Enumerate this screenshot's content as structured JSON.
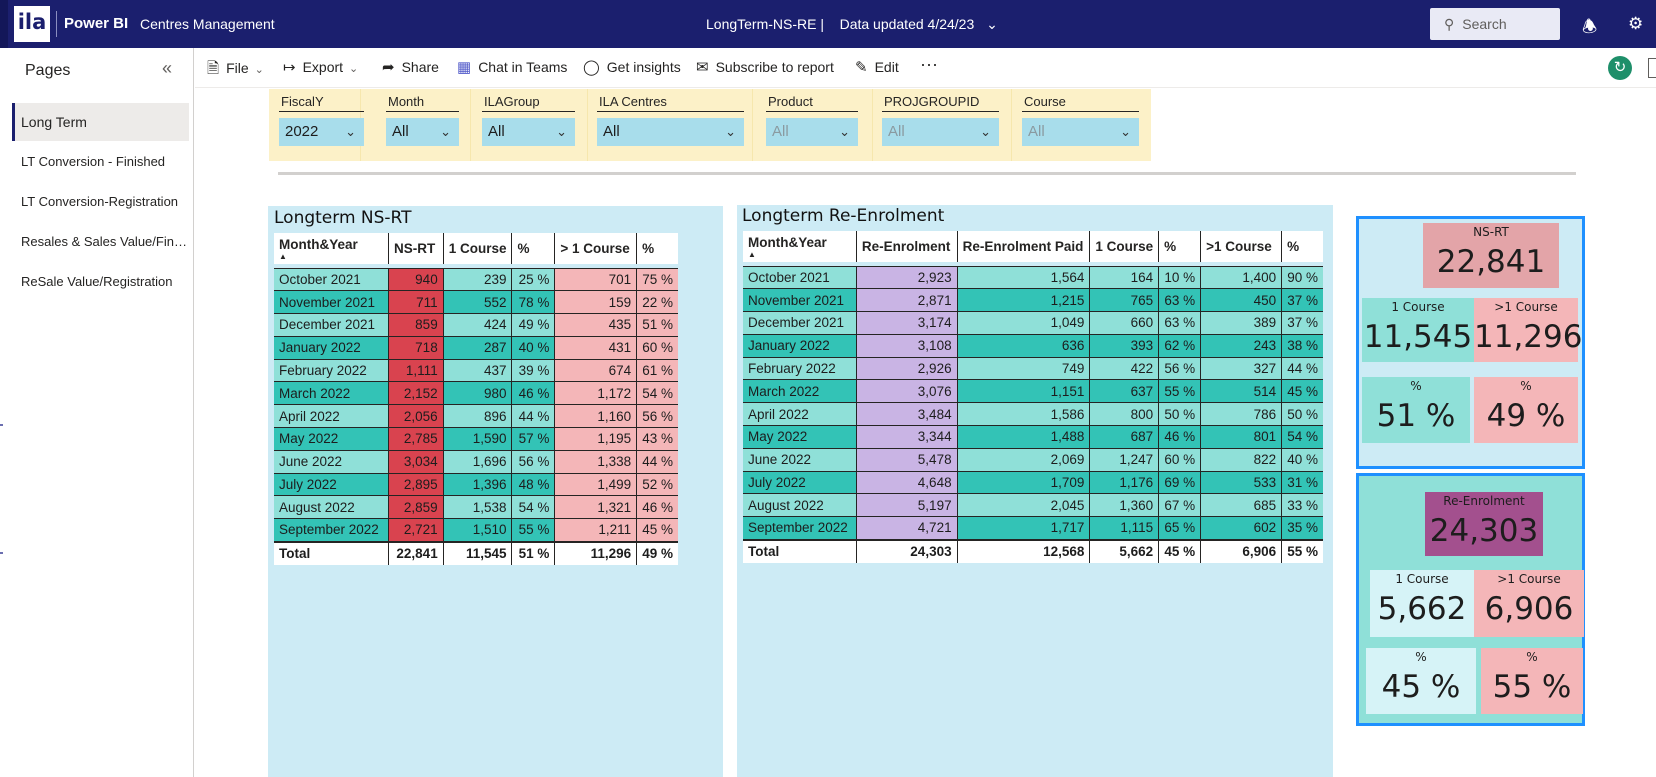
{
  "topbar": {
    "logo": "ila",
    "app_name": "Power BI",
    "workspace": "Centres Management",
    "report_title": "LongTerm-NS-RE  |",
    "data_updated": "Data updated 4/24/23",
    "search_placeholder": "Search"
  },
  "pages_pane": {
    "title": "Pages",
    "items": [
      {
        "label": "Long Term",
        "active": true
      },
      {
        "label": "LT Conversion - Finished",
        "active": false
      },
      {
        "label": "LT Conversion-Registration",
        "active": false
      },
      {
        "label": "Resales & Sales Value/Finished",
        "active": false
      },
      {
        "label": "ReSale Value/Registration",
        "active": false
      }
    ]
  },
  "actionbar": {
    "file": "File",
    "export": "Export",
    "share": "Share",
    "chat": "Chat in Teams",
    "insights": "Get insights",
    "subscribe": "Subscribe to report",
    "edit": "Edit",
    "more": "···"
  },
  "slicers": [
    {
      "label": "FiscalY",
      "value": "2022",
      "enabled": true
    },
    {
      "label": "Month",
      "value": "All",
      "enabled": true
    },
    {
      "label": "ILAGroup",
      "value": "All",
      "enabled": true
    },
    {
      "label": "ILA Centres",
      "value": "All",
      "enabled": true
    },
    {
      "label": "Product",
      "value": "All",
      "enabled": false
    },
    {
      "label": "PROJGROUPID",
      "value": "All",
      "enabled": false
    },
    {
      "label": "Course",
      "value": "All",
      "enabled": false
    }
  ],
  "nsrt": {
    "title": "Longterm NS-RT",
    "headers": [
      "Month&Year",
      "NS-RT",
      "1 Course",
      "%",
      "> 1 Course",
      "%"
    ],
    "rows": [
      [
        "October 2021",
        "940",
        "239",
        "25 %",
        "701",
        "75 %"
      ],
      [
        "November 2021",
        "711",
        "552",
        "78 %",
        "159",
        "22 %"
      ],
      [
        "December 2021",
        "859",
        "424",
        "49 %",
        "435",
        "51 %"
      ],
      [
        "January 2022",
        "718",
        "287",
        "40 %",
        "431",
        "60 %"
      ],
      [
        "February 2022",
        "1,111",
        "437",
        "39 %",
        "674",
        "61 %"
      ],
      [
        "March 2022",
        "2,152",
        "980",
        "46 %",
        "1,172",
        "54 %"
      ],
      [
        "April 2022",
        "2,056",
        "896",
        "44 %",
        "1,160",
        "56 %"
      ],
      [
        "May 2022",
        "2,785",
        "1,590",
        "57 %",
        "1,195",
        "43 %"
      ],
      [
        "June 2022",
        "3,034",
        "1,696",
        "56 %",
        "1,338",
        "44 %"
      ],
      [
        "July 2022",
        "2,895",
        "1,396",
        "48 %",
        "1,499",
        "52 %"
      ],
      [
        "August 2022",
        "2,859",
        "1,538",
        "54 %",
        "1,321",
        "46 %"
      ],
      [
        "September 2022",
        "2,721",
        "1,510",
        "55 %",
        "1,211",
        "45 %"
      ]
    ],
    "total": [
      "Total",
      "22,841",
      "11,545",
      "51 %",
      "11,296",
      "49 %"
    ]
  },
  "reenrol": {
    "title": "Longterm Re-Enrolment",
    "headers": [
      "Month&Year",
      "Re-Enrolment",
      "Re-Enrolment Paid",
      "1 Course",
      "%",
      ">1 Course",
      "%"
    ],
    "rows": [
      [
        "October 2021",
        "2,923",
        "1,564",
        "164",
        "10 %",
        "1,400",
        "90 %"
      ],
      [
        "November 2021",
        "2,871",
        "1,215",
        "765",
        "63 %",
        "450",
        "37 %"
      ],
      [
        "December 2021",
        "3,174",
        "1,049",
        "660",
        "63 %",
        "389",
        "37 %"
      ],
      [
        "January 2022",
        "3,108",
        "636",
        "393",
        "62 %",
        "243",
        "38 %"
      ],
      [
        "February 2022",
        "2,926",
        "749",
        "422",
        "56 %",
        "327",
        "44 %"
      ],
      [
        "March 2022",
        "3,076",
        "1,151",
        "637",
        "55 %",
        "514",
        "45 %"
      ],
      [
        "April 2022",
        "3,484",
        "1,586",
        "800",
        "50 %",
        "786",
        "50 %"
      ],
      [
        "May 2022",
        "3,344",
        "1,488",
        "687",
        "46 %",
        "801",
        "54 %"
      ],
      [
        "June 2022",
        "5,478",
        "2,069",
        "1,247",
        "60 %",
        "822",
        "40 %"
      ],
      [
        "July 2022",
        "4,648",
        "1,709",
        "1,176",
        "69 %",
        "533",
        "31 %"
      ],
      [
        "August 2022",
        "5,197",
        "2,045",
        "1,360",
        "67 %",
        "685",
        "33 %"
      ],
      [
        "September 2022",
        "4,721",
        "1,717",
        "1,115",
        "65 %",
        "602",
        "35 %"
      ]
    ],
    "total": [
      "Total",
      "24,303",
      "12,568",
      "5,662",
      "45 %",
      "6,906",
      "55 %"
    ]
  },
  "kpi_nsrt": {
    "main_label": "NS-RT",
    "main_value": "22,841",
    "one_label": "1 Course",
    "one_value": "11,545",
    "multi_label": ">1 Course",
    "multi_value": "11,296",
    "pct1_label": "%",
    "pct1_value": "51 %",
    "pct2_label": "%",
    "pct2_value": "49 %"
  },
  "kpi_reenrol": {
    "main_label": "Re-Enrolment",
    "main_value": "24,303",
    "one_label": "1 Course",
    "one_value": "5,662",
    "multi_label": ">1 Course",
    "multi_value": "6,906",
    "pct1_label": "%",
    "pct1_value": "45 %",
    "pct2_label": "%",
    "pct2_value": "55 %"
  },
  "colors": {
    "topbar": "#1b1f6e",
    "panel_bg": "#cdebf5",
    "slicer_band": "#fcf1c8",
    "slicer_box": "#a8ddeb",
    "teal_light": "#8fe0d8",
    "teal_dark": "#33c3b6",
    "red_dark": "#d9434f",
    "pink": "#f4b6b8",
    "lavender": "#c9b4e4",
    "kpi_border": "#1e90ff",
    "kpi_purple": "#a3508e",
    "kpi_rose": "#e3a4a8"
  }
}
